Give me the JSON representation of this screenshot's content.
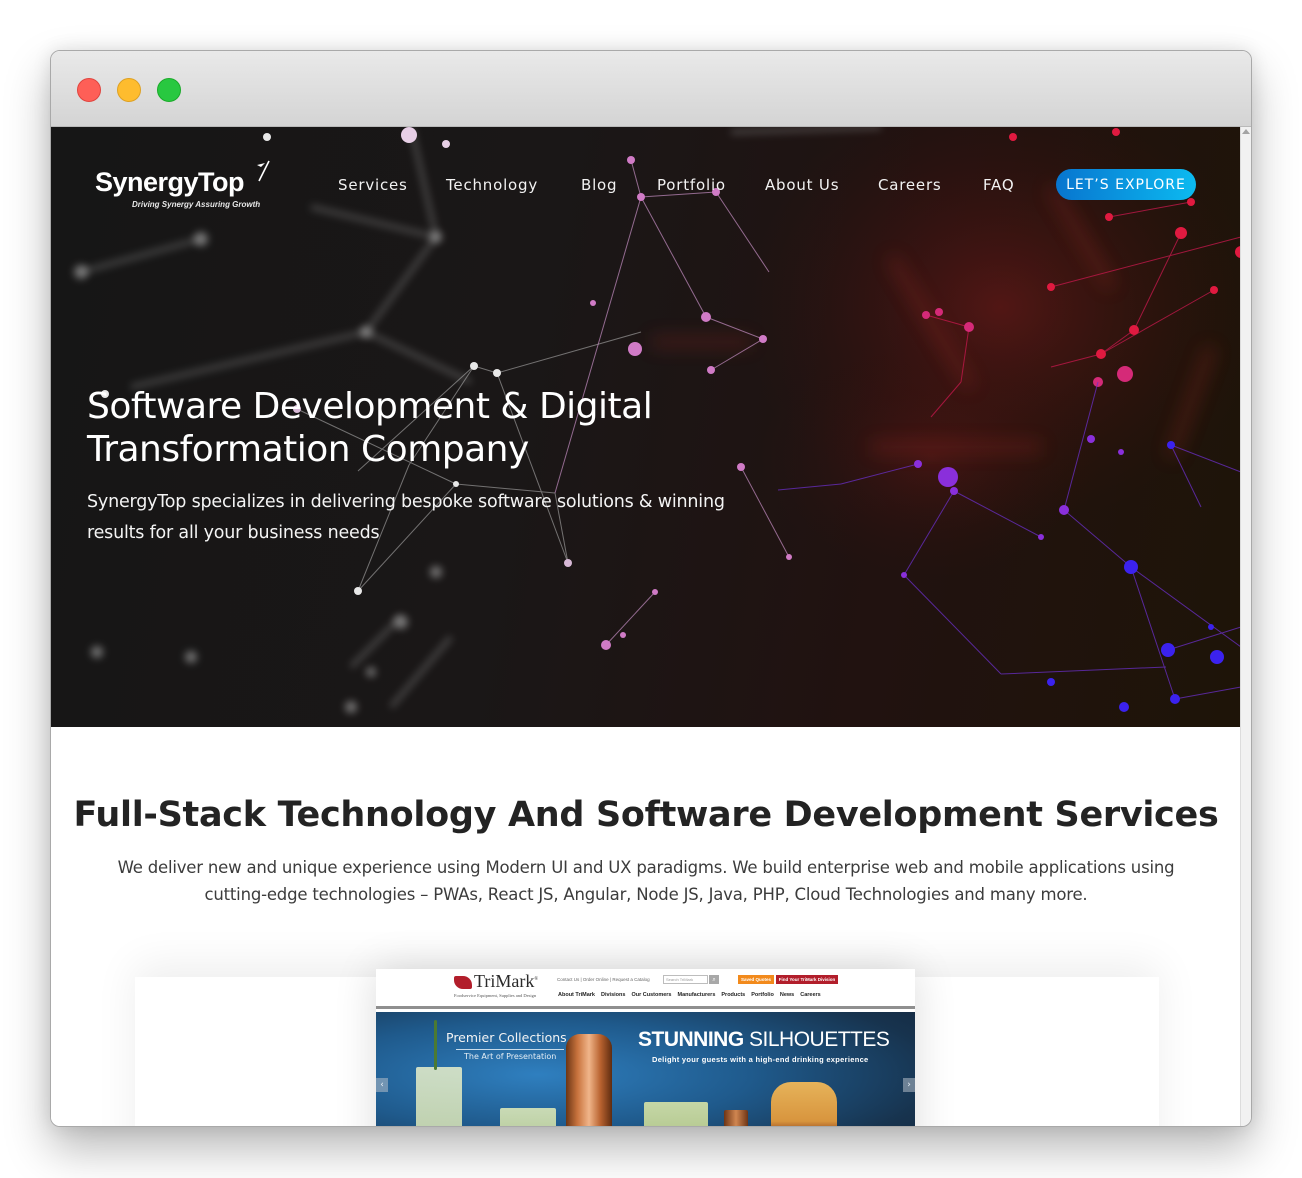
{
  "window": {
    "traffic_lights": [
      "close",
      "minimize",
      "maximize"
    ]
  },
  "header": {
    "logo": {
      "name": "SynergyTop",
      "tagline": "Driving Synergy Assuring Growth"
    },
    "nav": [
      {
        "label": "Services"
      },
      {
        "label": "Technology"
      },
      {
        "label": "Blog"
      },
      {
        "label": "Portfolio"
      },
      {
        "label": "About Us"
      },
      {
        "label": "Careers"
      },
      {
        "label": "FAQ"
      }
    ],
    "cta_label": "LET’S EXPLORE"
  },
  "hero": {
    "title": "Software Development & Digital Transformation Company",
    "subtitle": "SynergyTop specializes in delivering bespoke software solutions & winning results for all your business needs"
  },
  "services": {
    "title": "Full-Stack Technology And Software Development Services",
    "description": "We deliver new and unique experience using Modern UI and UX paradigms. We build enterprise web and mobile applications using cutting-edge technologies – PWAs, React JS, Angular, Node JS, Java, PHP, Cloud Technologies and many more."
  },
  "portfolio_preview": {
    "site_logo": "TriMark",
    "site_tagline": "Foodservice Equipment, Supplies and Design",
    "utility_links": "Contact Us | Order Online | Request a Catalog",
    "search_placeholder": "Search TriMark",
    "saved_quotes_label": "Saved Quotes",
    "division_label": "Find Your TriMark Division",
    "nav": [
      "About TriMark",
      "Divisions",
      "Our Customers",
      "Manufacturers",
      "Products",
      "Portfolio",
      "News",
      "Careers"
    ],
    "banner_left_title": "Premier Collections",
    "banner_left_subtitle": "The Art of Presentation",
    "banner_right_title_bold": "STUNNING",
    "banner_right_title_light": " SILHOUETTES",
    "banner_right_subtitle": "Delight your guests with a high-end drinking experience",
    "prev_arrow": "‹",
    "next_arrow": "›"
  },
  "colors": {
    "cta_gradient_start": "#0875cf",
    "cta_gradient_end": "#0cbaf0",
    "hero_bg": "#171717",
    "trimark_red": "#b21e2b",
    "trimark_orange": "#f28a1c"
  }
}
